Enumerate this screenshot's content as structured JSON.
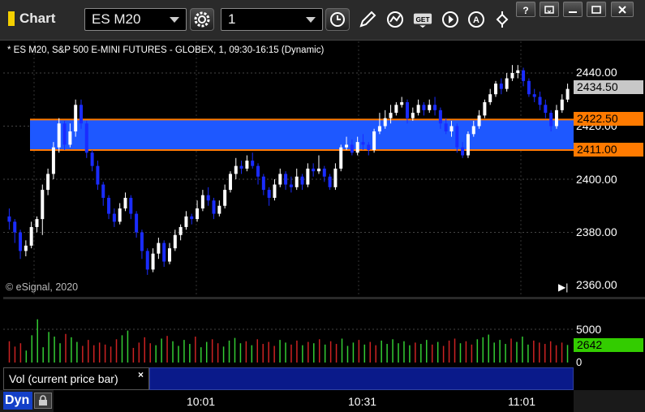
{
  "window": {
    "title": "Chart",
    "minimize_label": "",
    "icons": {
      "chart": "chart-window-icon"
    }
  },
  "toolbar": {
    "symbol": "ES M20",
    "interval": "1",
    "buttons": [
      "settings-gear",
      "time-clock",
      "draw-pencil",
      "studies",
      "get-data",
      "play",
      "alert",
      "links"
    ]
  },
  "chart": {
    "description": "* ES M20, S&P 500 E-MINI FUTURES - GLOBEX, 1, 09:30-16:15 (Dynamic)",
    "copyright": "© eSignal, 2020",
    "price_ticks": [
      "2440.00",
      "2420.00",
      "2400.00",
      "2380.00",
      "2360.00"
    ],
    "last_price": "2434.50",
    "upper_level": "2422.50",
    "lower_level": "2411.00",
    "colors": {
      "band": "#1e58ff",
      "level": "#ff7a00",
      "up": "#ffffff",
      "down": "#1a2cff",
      "badge_last": "#c8c8c8",
      "vol_last": "#33cc00"
    }
  },
  "volume": {
    "legend": "Vol (current price bar)",
    "close": "×",
    "ticks": [
      "5000",
      "0"
    ],
    "last": "2642"
  },
  "time_axis": {
    "mode": "Dyn",
    "labels": [
      "10:01",
      "10:31",
      "11:01"
    ]
  },
  "chart_data": {
    "type": "candlestick",
    "ylim": [
      2355,
      2448
    ],
    "bands": [
      {
        "low": 2411.0,
        "high": 2422.5
      }
    ],
    "levels": [
      2422.5,
      2411.0
    ],
    "candles": [
      [
        2386,
        2384,
        2389,
        2381
      ],
      [
        2384,
        2380,
        2385,
        2376
      ],
      [
        2380,
        2373,
        2381,
        2370
      ],
      [
        2373,
        2375,
        2377,
        2371
      ],
      [
        2375,
        2382,
        2384,
        2374
      ],
      [
        2382,
        2385,
        2386,
        2380
      ],
      [
        2385,
        2396,
        2398,
        2379
      ],
      [
        2396,
        2402,
        2404,
        2394
      ],
      [
        2402,
        2412,
        2414,
        2400
      ],
      [
        2412,
        2421,
        2423,
        2410
      ],
      [
        2421,
        2413,
        2422,
        2411
      ],
      [
        2413,
        2418,
        2421,
        2412
      ],
      [
        2418,
        2428,
        2430,
        2416
      ],
      [
        2428,
        2421,
        2430,
        2419
      ],
      [
        2421,
        2410,
        2422,
        2408
      ],
      [
        2410,
        2405,
        2411,
        2403
      ],
      [
        2405,
        2398,
        2407,
        2396
      ],
      [
        2398,
        2393,
        2399,
        2390
      ],
      [
        2393,
        2387,
        2394,
        2385
      ],
      [
        2387,
        2384,
        2389,
        2382
      ],
      [
        2384,
        2389,
        2391,
        2383
      ],
      [
        2389,
        2393,
        2395,
        2388
      ],
      [
        2393,
        2387,
        2394,
        2385
      ],
      [
        2387,
        2380,
        2388,
        2378
      ],
      [
        2380,
        2373,
        2381,
        2370
      ],
      [
        2373,
        2366,
        2374,
        2364
      ],
      [
        2366,
        2372,
        2374,
        2365
      ],
      [
        2372,
        2376,
        2378,
        2370
      ],
      [
        2376,
        2369,
        2377,
        2367
      ],
      [
        2369,
        2374,
        2376,
        2368
      ],
      [
        2374,
        2379,
        2381,
        2373
      ],
      [
        2379,
        2382,
        2383,
        2377
      ],
      [
        2382,
        2386,
        2388,
        2381
      ],
      [
        2386,
        2385,
        2387,
        2383
      ],
      [
        2385,
        2389,
        2392,
        2384
      ],
      [
        2389,
        2394,
        2396,
        2388
      ],
      [
        2394,
        2392,
        2397,
        2390
      ],
      [
        2392,
        2387,
        2393,
        2385
      ],
      [
        2387,
        2390,
        2392,
        2386
      ],
      [
        2390,
        2396,
        2398,
        2389
      ],
      [
        2396,
        2402,
        2403,
        2395
      ],
      [
        2402,
        2405,
        2408,
        2400
      ],
      [
        2405,
        2404,
        2407,
        2402
      ],
      [
        2404,
        2407,
        2409,
        2403
      ],
      [
        2407,
        2405,
        2410,
        2404
      ],
      [
        2405,
        2401,
        2406,
        2398
      ],
      [
        2401,
        2396,
        2402,
        2394
      ],
      [
        2396,
        2393,
        2397,
        2390
      ],
      [
        2393,
        2398,
        2400,
        2392
      ],
      [
        2398,
        2402,
        2404,
        2397
      ],
      [
        2402,
        2398,
        2403,
        2396
      ],
      [
        2398,
        2397,
        2401,
        2395
      ],
      [
        2397,
        2401,
        2404,
        2396
      ],
      [
        2401,
        2398,
        2402,
        2396
      ],
      [
        2398,
        2404,
        2406,
        2397
      ],
      [
        2404,
        2403,
        2406,
        2401
      ],
      [
        2403,
        2404,
        2409,
        2402
      ],
      [
        2404,
        2401,
        2405,
        2399
      ],
      [
        2401,
        2397,
        2402,
        2396
      ],
      [
        2397,
        2404,
        2406,
        2396
      ],
      [
        2404,
        2412,
        2413,
        2403
      ],
      [
        2412,
        2413,
        2416,
        2411
      ],
      [
        2413,
        2410,
        2415,
        2409
      ],
      [
        2410,
        2414,
        2416,
        2409
      ],
      [
        2414,
        2413,
        2417,
        2411
      ],
      [
        2413,
        2411,
        2414,
        2409
      ],
      [
        2411,
        2418,
        2419,
        2410
      ],
      [
        2418,
        2420,
        2425,
        2417
      ],
      [
        2420,
        2423,
        2426,
        2419
      ],
      [
        2423,
        2425,
        2428,
        2421
      ],
      [
        2425,
        2428,
        2429,
        2424
      ],
      [
        2428,
        2429,
        2431,
        2427
      ],
      [
        2429,
        2423,
        2430,
        2421
      ],
      [
        2423,
        2425,
        2427,
        2422
      ],
      [
        2425,
        2428,
        2430,
        2424
      ],
      [
        2428,
        2426,
        2429,
        2424
      ],
      [
        2426,
        2428,
        2430,
        2425
      ],
      [
        2428,
        2426,
        2431,
        2424
      ],
      [
        2426,
        2421,
        2427,
        2419
      ],
      [
        2421,
        2418,
        2423,
        2417
      ],
      [
        2418,
        2420,
        2422,
        2416
      ],
      [
        2420,
        2412,
        2421,
        2410
      ],
      [
        2412,
        2409,
        2414,
        2408
      ],
      [
        2409,
        2417,
        2418,
        2408
      ],
      [
        2417,
        2420,
        2422,
        2416
      ],
      [
        2420,
        2424,
        2426,
        2419
      ],
      [
        2424,
        2429,
        2430,
        2423
      ],
      [
        2429,
        2432,
        2434,
        2428
      ],
      [
        2432,
        2436,
        2437,
        2431
      ],
      [
        2436,
        2434,
        2438,
        2432
      ],
      [
        2434,
        2438,
        2440,
        2433
      ],
      [
        2438,
        2440,
        2443,
        2437
      ],
      [
        2440,
        2441,
        2443,
        2438
      ],
      [
        2441,
        2437,
        2442,
        2435
      ],
      [
        2437,
        2432,
        2438,
        2431
      ],
      [
        2432,
        2431,
        2434,
        2429
      ],
      [
        2431,
        2428,
        2433,
        2426
      ],
      [
        2428,
        2425,
        2430,
        2423
      ],
      [
        2425,
        2420,
        2426,
        2418
      ],
      [
        2420,
        2426,
        2428,
        2419
      ],
      [
        2426,
        2430,
        2432,
        2425
      ],
      [
        2430,
        2434,
        2436,
        2429
      ]
    ],
    "volume": [
      3200,
      2400,
      2900,
      1800,
      4100,
      6500,
      2300,
      4600,
      3900,
      2900,
      4300,
      3800,
      3100,
      2500,
      3400,
      2600,
      3000,
      2700,
      2400,
      3500,
      4100,
      4800,
      2200,
      3000,
      3800,
      2900,
      2600,
      3600,
      4000,
      3200,
      2500,
      3400,
      2800,
      3900,
      2300,
      3100,
      3500,
      2900,
      2400,
      3300,
      3700,
      2900,
      3200,
      2600,
      3500,
      2800,
      3100,
      2500,
      3400,
      3000,
      2700,
      3300,
      2600,
      3100,
      2900,
      3500,
      2700,
      3200,
      2800,
      3600,
      2500,
      3000,
      3400,
      2700,
      3100,
      2600,
      3300,
      2800,
      3500,
      2900,
      3200,
      2600,
      3000,
      2800,
      3400,
      2700,
      3100,
      2500,
      3300,
      3600,
      2900,
      3200,
      2700,
      3500,
      3800,
      4200,
      3000,
      3400,
      2800,
      3600,
      3100,
      3900,
      2700,
      3300,
      3000,
      2800,
      3200,
      2600,
      3000,
      2642
    ]
  }
}
